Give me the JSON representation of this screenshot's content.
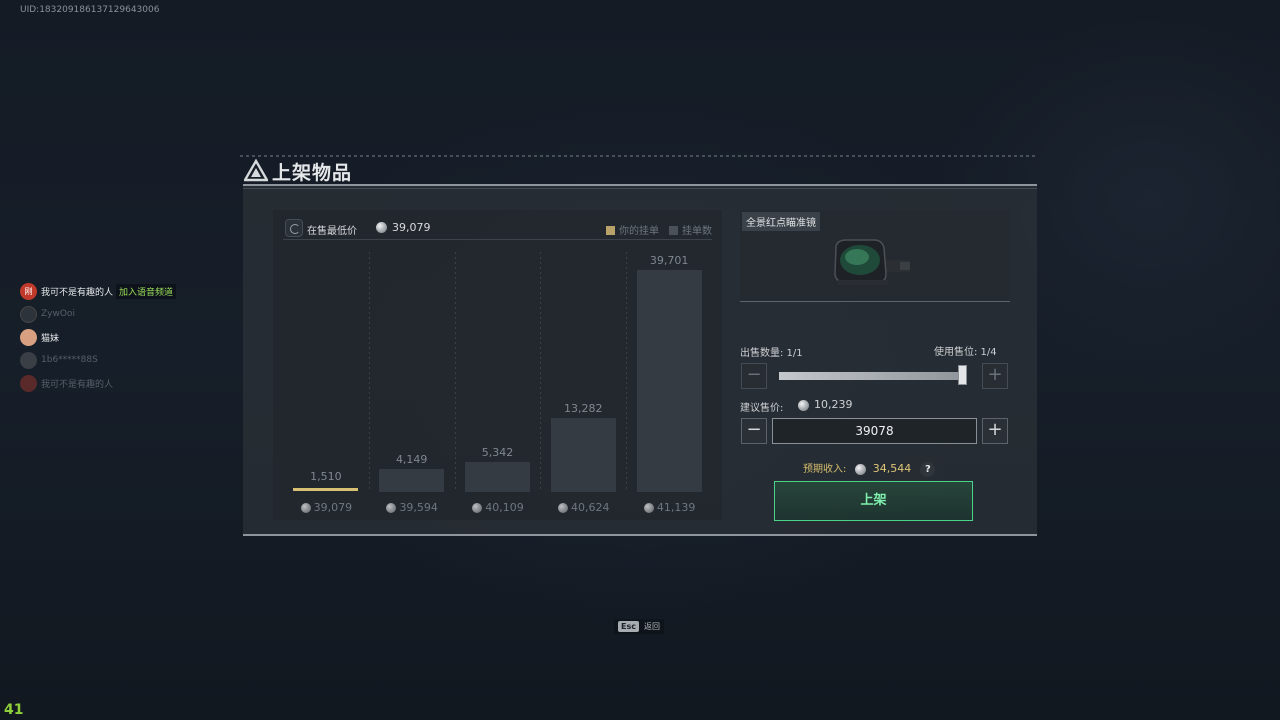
{
  "hud": {
    "uid": "UID:1832091861371296430​06",
    "fps": "41"
  },
  "voice": {
    "users": [
      {
        "name": "我可不是有趣的人",
        "tag": "加入语音频道",
        "dim": false,
        "avatar_color": "#c0392b",
        "avatar_text": "刚"
      },
      {
        "name": "ZywOoi",
        "tag": "",
        "dim": true,
        "avatar_color": "#2d333a",
        "avatar_text": ""
      },
      {
        "name": "猫妹",
        "tag": "",
        "dim": false,
        "avatar_color": "#d8a080",
        "avatar_text": ""
      },
      {
        "name": "1b6*****88S",
        "tag": "",
        "dim": true,
        "avatar_color": "#3a3f45",
        "avatar_text": ""
      },
      {
        "name": "我可不是有趣的人",
        "tag": "",
        "dim": true,
        "avatar_color": "#5a2a2a",
        "avatar_text": ""
      }
    ]
  },
  "dialog": {
    "title": "上架物品"
  },
  "market": {
    "lowest_label": "在售最低价",
    "lowest_value": "39,079",
    "legend_yours": "你的挂单",
    "legend_count": "挂单数"
  },
  "chart_data": {
    "type": "bar",
    "categories": [
      "39,079",
      "39,594",
      "40,109",
      "40,624",
      "41,139"
    ],
    "values": [
      1510,
      4149,
      5342,
      13282,
      39701
    ],
    "value_labels": [
      "1,510",
      "4,149",
      "5,342",
      "13,282",
      "39,701"
    ],
    "your_listing_index": 0,
    "ylim": [
      0,
      39701
    ],
    "series": [
      {
        "name": "挂单数",
        "values": [
          1510,
          4149,
          5342,
          13282,
          39701
        ]
      }
    ]
  },
  "item": {
    "name": "全景红点瞄准镜"
  },
  "form": {
    "sell_qty_label": "出售数量: 1/1",
    "slots_label": "使用售位: 1/4",
    "suggest_label": "建议售价:",
    "suggest_value": "10,239",
    "price_value": "39078",
    "income_label": "预期收入:",
    "income_value": "34,544",
    "help": "?",
    "minus": "−",
    "plus": "+",
    "submit": "上架",
    "quantity_fraction": 1.0
  },
  "footer": {
    "esc_key": "Esc",
    "esc_label": "返回"
  },
  "colors": {
    "accent_green": "#4bd38a",
    "gold": "#d6c173"
  }
}
